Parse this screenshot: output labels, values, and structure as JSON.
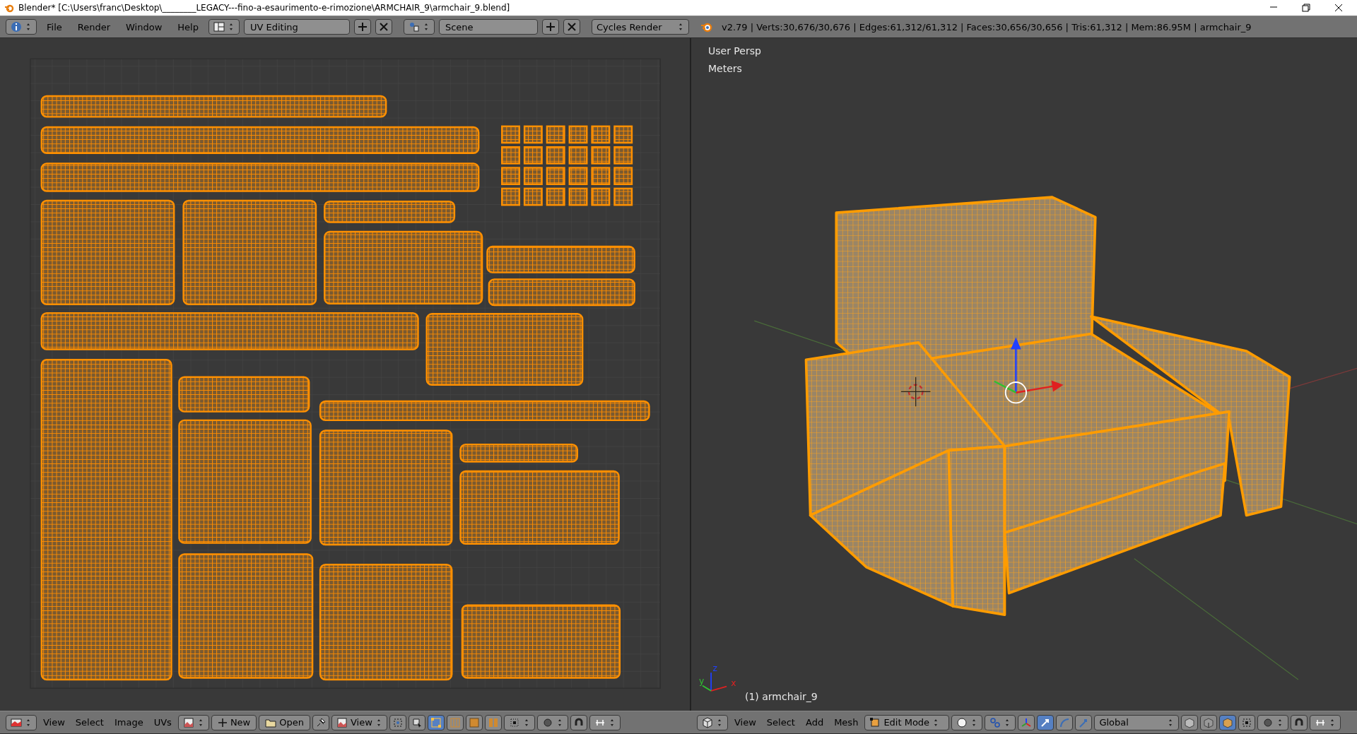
{
  "title_bar": {
    "title": "Blender* [C:\\Users\\franc\\Desktop\\________LEGACY---fino-a-esaurimento-e-rimozione\\ARMCHAIR_9\\armchair_9.blend]"
  },
  "info_header": {
    "menus": [
      "File",
      "Render",
      "Window",
      "Help"
    ],
    "screen_layout": "UV Editing",
    "scene": "Scene",
    "render_engine": "Cycles Render",
    "stats": "v2.79 | Verts:30,676/30,676 | Edges:61,312/61,312 | Faces:30,656/30,656 | Tris:61,312 | Mem:86.95M | armchair_9"
  },
  "uv_editor": {
    "header": {
      "menus": [
        "View",
        "Select",
        "Image",
        "UVs"
      ],
      "new_button": "New",
      "open_button": "Open",
      "view_mode": "View",
      "select_modes": [
        {
          "kind": "vertex",
          "selected": true
        },
        {
          "kind": "edge",
          "selected": false
        },
        {
          "kind": "face",
          "selected": false
        },
        {
          "kind": "island",
          "selected": false
        }
      ]
    }
  },
  "viewport": {
    "view_name": "User Persp",
    "units": "Meters",
    "object_label": "(1) armchair_9",
    "axis_labels": [
      "x",
      "y",
      "z"
    ],
    "header": {
      "menus": [
        "View",
        "Select",
        "Add",
        "Mesh"
      ],
      "mode": "Edit Mode",
      "orientation": "Global",
      "manipulators": [
        {
          "kind": "translate",
          "selected": true
        },
        {
          "kind": "rotate",
          "selected": false
        },
        {
          "kind": "scale",
          "selected": false
        }
      ],
      "mesh_select_modes": [
        {
          "kind": "vertex",
          "selected": false
        },
        {
          "kind": "edge",
          "selected": false
        },
        {
          "kind": "face",
          "selected": true
        }
      ]
    }
  }
}
